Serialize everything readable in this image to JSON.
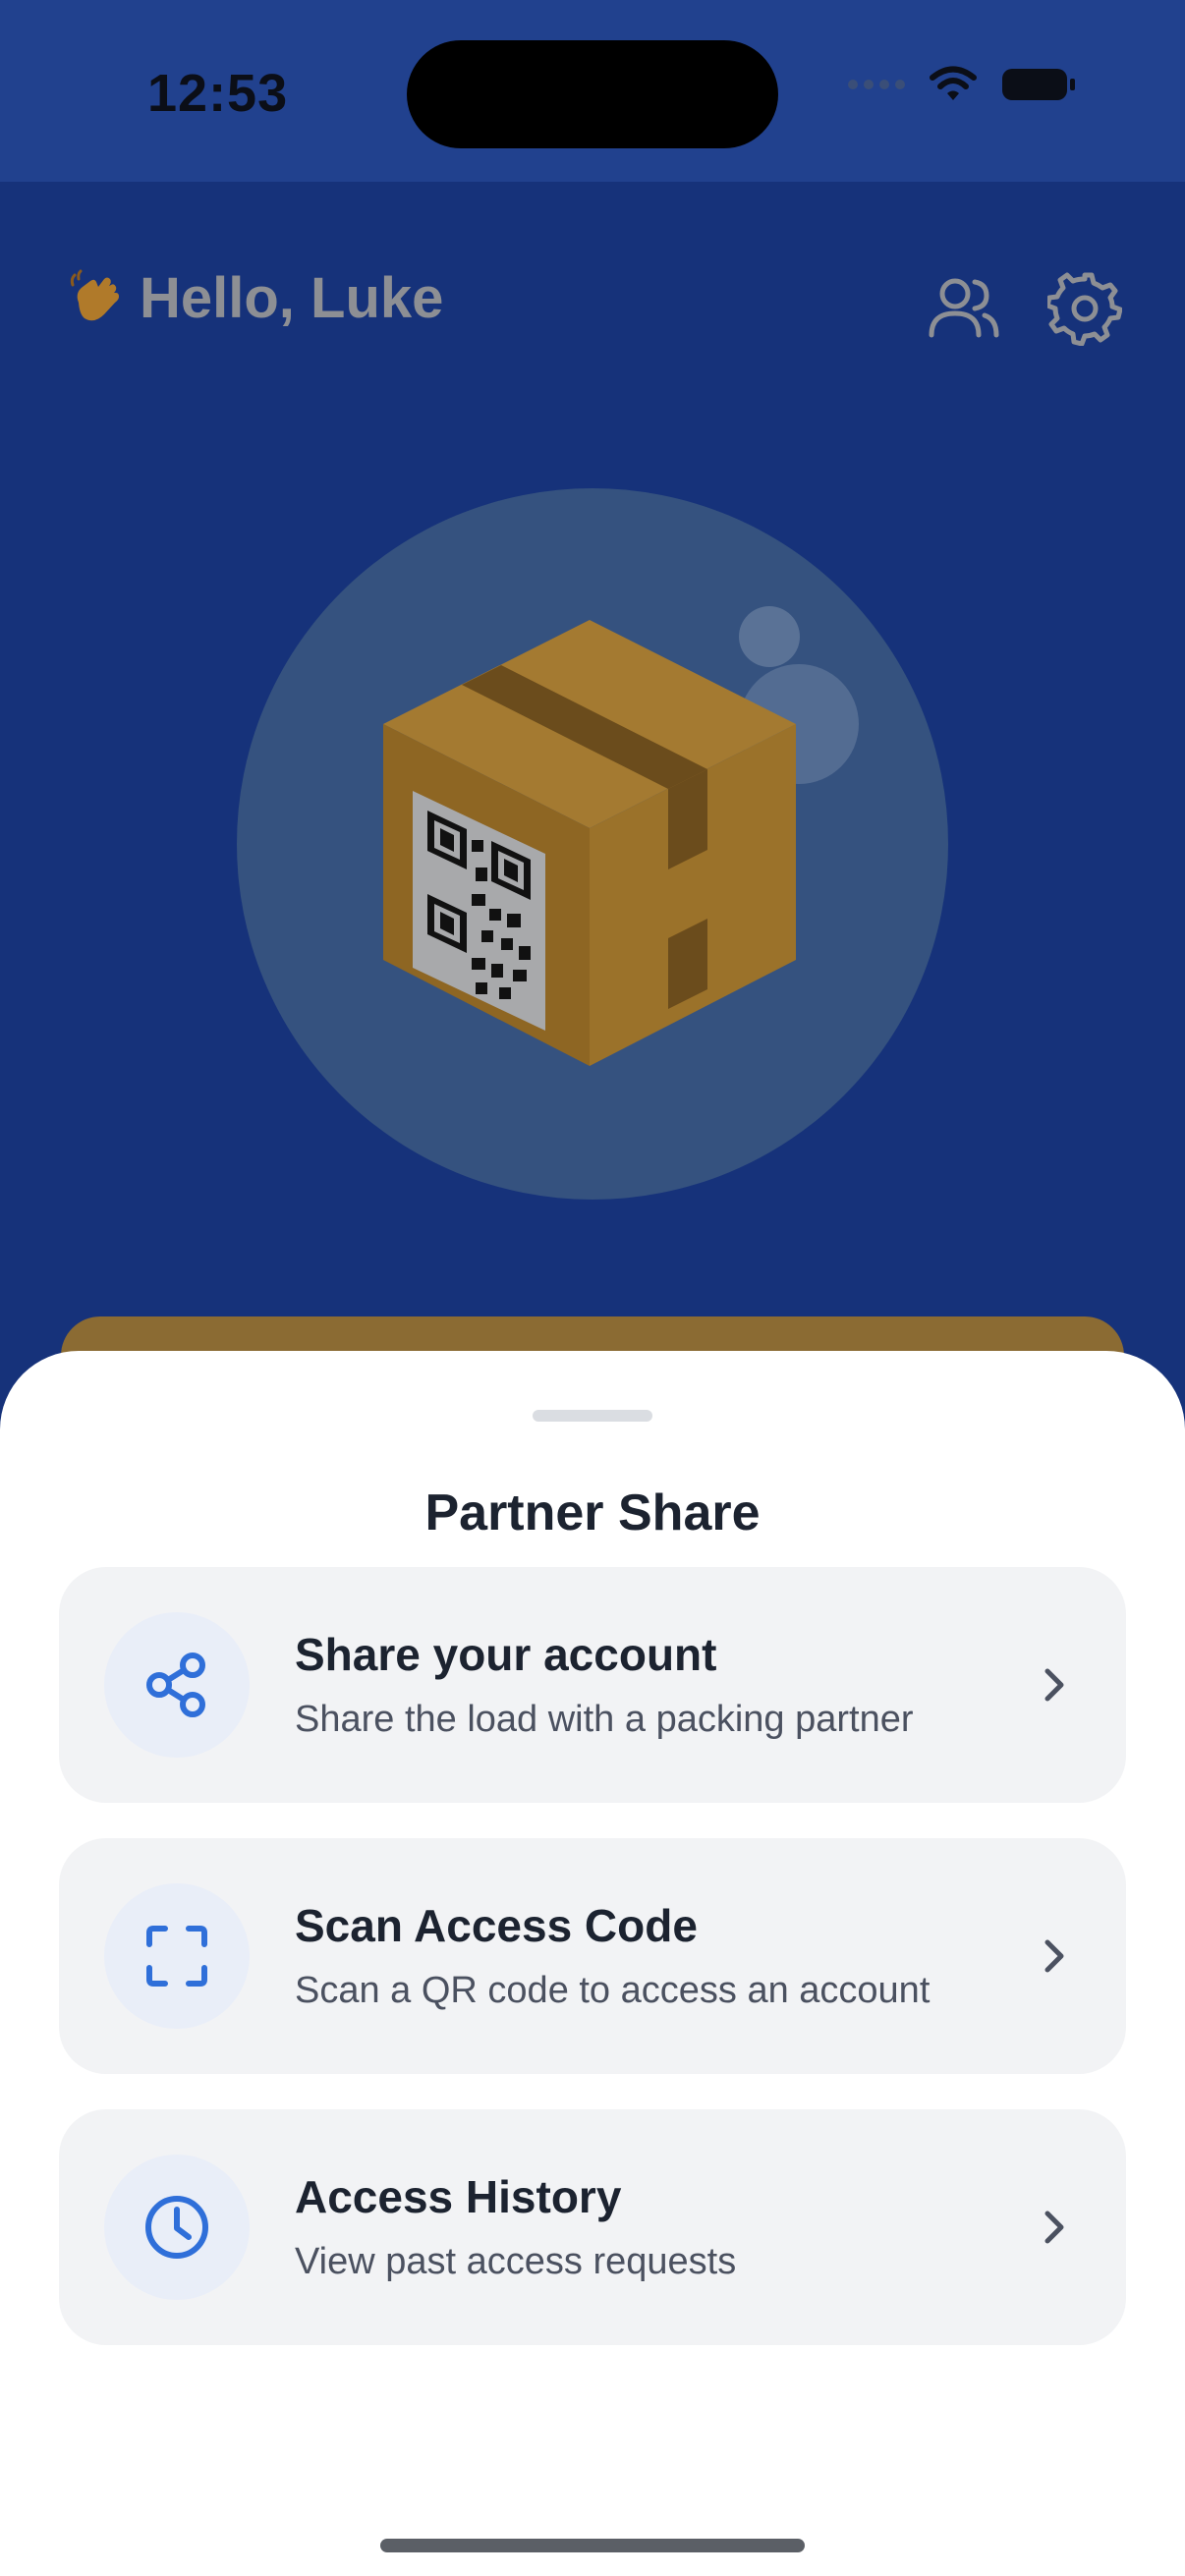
{
  "status_bar": {
    "time": "12:53"
  },
  "header": {
    "greeting": "Hello, Luke"
  },
  "sheet": {
    "title": "Partner Share",
    "options": [
      {
        "title": "Share your account",
        "subtitle": "Share the load with a packing partner",
        "icon": "share-icon"
      },
      {
        "title": "Scan Access Code",
        "subtitle": "Scan a QR code to access an account",
        "icon": "scan-icon"
      },
      {
        "title": "Access History",
        "subtitle": "View past access requests",
        "icon": "clock-icon"
      }
    ]
  },
  "colors": {
    "accent": "#2f6fd9",
    "backdrop": "#16327a",
    "card": "#f2f3f5"
  }
}
